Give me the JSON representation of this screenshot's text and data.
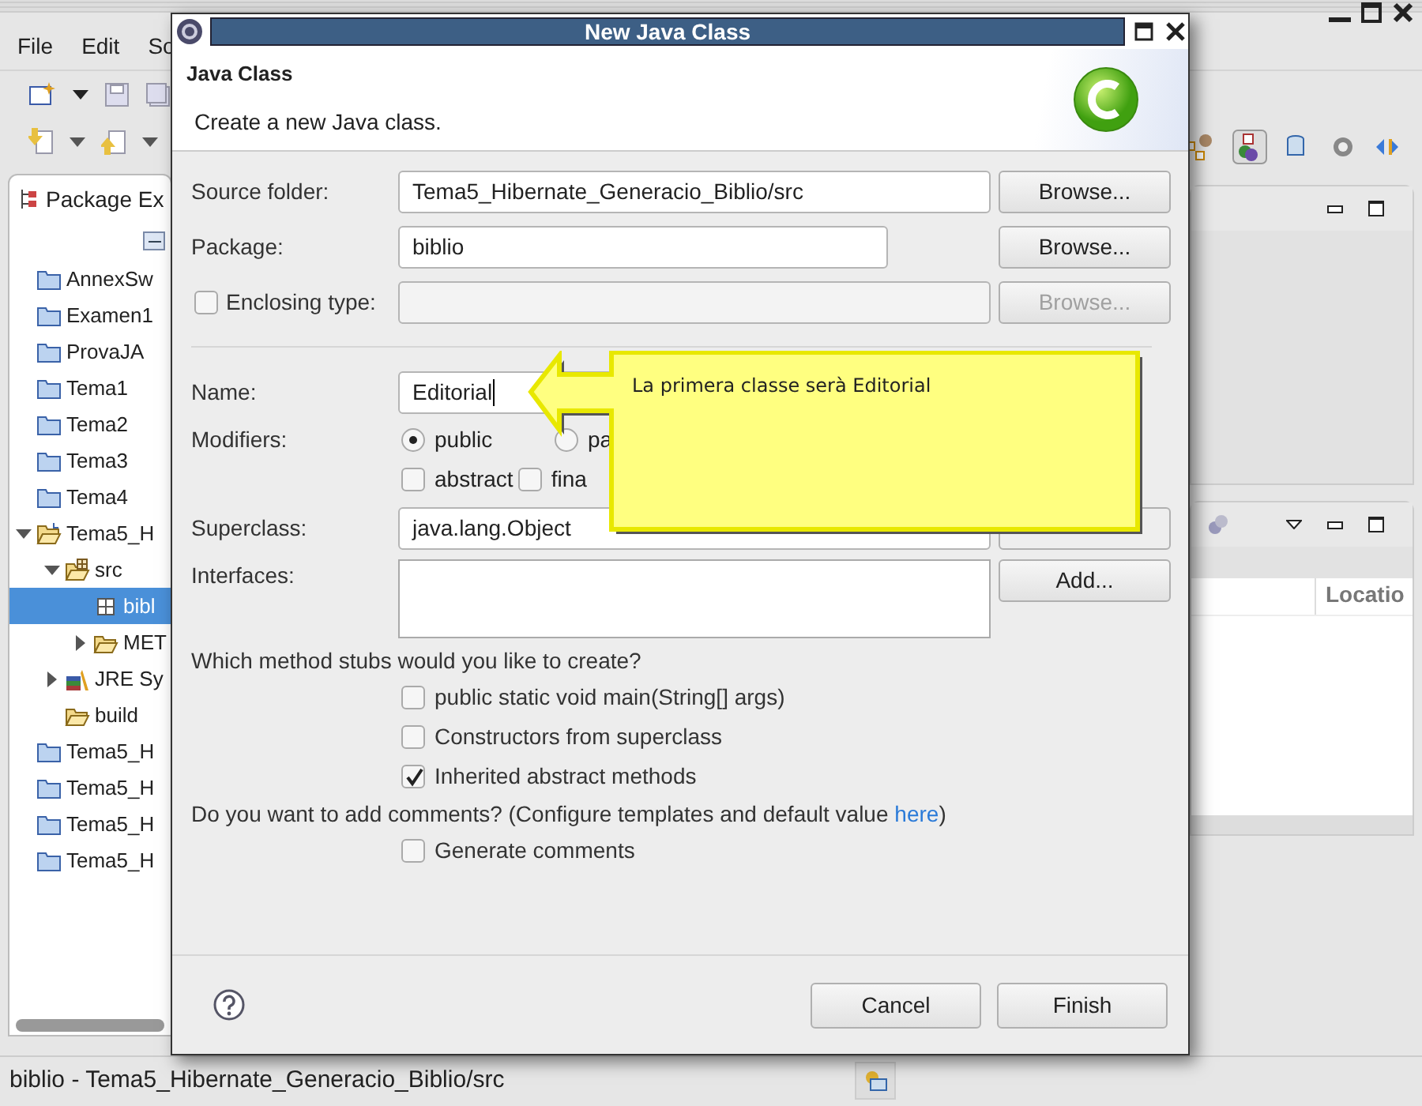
{
  "workbench": {
    "menu": [
      "File",
      "Edit",
      "So"
    ],
    "package_explorer": {
      "tab": "Package Ex",
      "tree": [
        {
          "label": "AnnexSw",
          "kind": "project",
          "selected": false
        },
        {
          "label": "Examen1",
          "kind": "project",
          "selected": false
        },
        {
          "label": "ProvaJA",
          "kind": "project",
          "selected": false
        },
        {
          "label": "Tema1",
          "kind": "project",
          "selected": false
        },
        {
          "label": "Tema2",
          "kind": "project",
          "selected": false
        },
        {
          "label": "Tema3",
          "kind": "project",
          "selected": false
        },
        {
          "label": "Tema4",
          "kind": "project",
          "selected": false
        },
        {
          "label": "Tema5_H",
          "kind": "project-open",
          "selected": false,
          "expanded": true,
          "children": [
            {
              "label": "src",
              "kind": "source-folder",
              "selected": false,
              "expanded": true,
              "children": [
                {
                  "label": "bibl",
                  "kind": "package",
                  "selected": true
                },
                {
                  "label": "MET",
                  "kind": "folder",
                  "selected": false,
                  "expanded": false
                }
              ]
            },
            {
              "label": "JRE Sy",
              "kind": "library",
              "selected": false,
              "expanded": false
            },
            {
              "label": "build",
              "kind": "folder",
              "selected": false
            }
          ]
        },
        {
          "label": "Tema5_H",
          "kind": "project",
          "selected": false
        },
        {
          "label": "Tema5_H",
          "kind": "project",
          "selected": false
        },
        {
          "label": "Tema5_H",
          "kind": "project",
          "selected": false
        },
        {
          "label": "Tema5_H",
          "kind": "project",
          "selected": false
        }
      ]
    },
    "lower_panel": {
      "columns": [
        "Locatio"
      ]
    },
    "status_bar": "biblio - Tema5_Hibernate_Generacio_Biblio/src"
  },
  "dialog": {
    "title": "New Java Class",
    "heading": "Java Class",
    "description": "Create a new Java class.",
    "rows": [
      {
        "kind": "field",
        "label": "Source folder:",
        "value": "Tema5_Hibernate_Generacio_Biblio/src",
        "button": "Browse...",
        "disabled": false
      },
      {
        "kind": "short-field",
        "label": "Package:",
        "value": "biblio",
        "button": "Browse...",
        "disabled": false
      },
      {
        "kind": "check-field",
        "label": "Enclosing type:",
        "checked": false,
        "value": "",
        "button": "Browse...",
        "disabled": true
      }
    ],
    "name": {
      "label": "Name:",
      "value": "Editorial"
    },
    "modifiers": {
      "label": "Modifiers:",
      "radios": [
        {
          "label": "public",
          "selected": true
        },
        {
          "label": "pa",
          "selected": false
        }
      ],
      "checks": [
        {
          "label": "abstract",
          "checked": false
        },
        {
          "label": "fina",
          "checked": false
        }
      ]
    },
    "superclass": {
      "label": "Superclass:",
      "value": "java.lang.Object"
    },
    "interfaces": {
      "label": "Interfaces:",
      "button": "Add..."
    },
    "stubs": {
      "question": "Which method stubs would you like to create?",
      "options": [
        {
          "label": "public static void main(String[] args)",
          "checked": false
        },
        {
          "label": "Constructors from superclass",
          "checked": false
        },
        {
          "label": "Inherited abstract methods",
          "checked": true
        }
      ]
    },
    "comments": {
      "before": "Do you want to add comments? (Configure templates and default value ",
      "link": "here",
      "after": ")",
      "option": {
        "label": "Generate comments",
        "checked": false
      }
    },
    "buttons": [
      "Cancel",
      "Finish"
    ]
  },
  "callout": {
    "text": "La primera classe serà Editorial"
  }
}
